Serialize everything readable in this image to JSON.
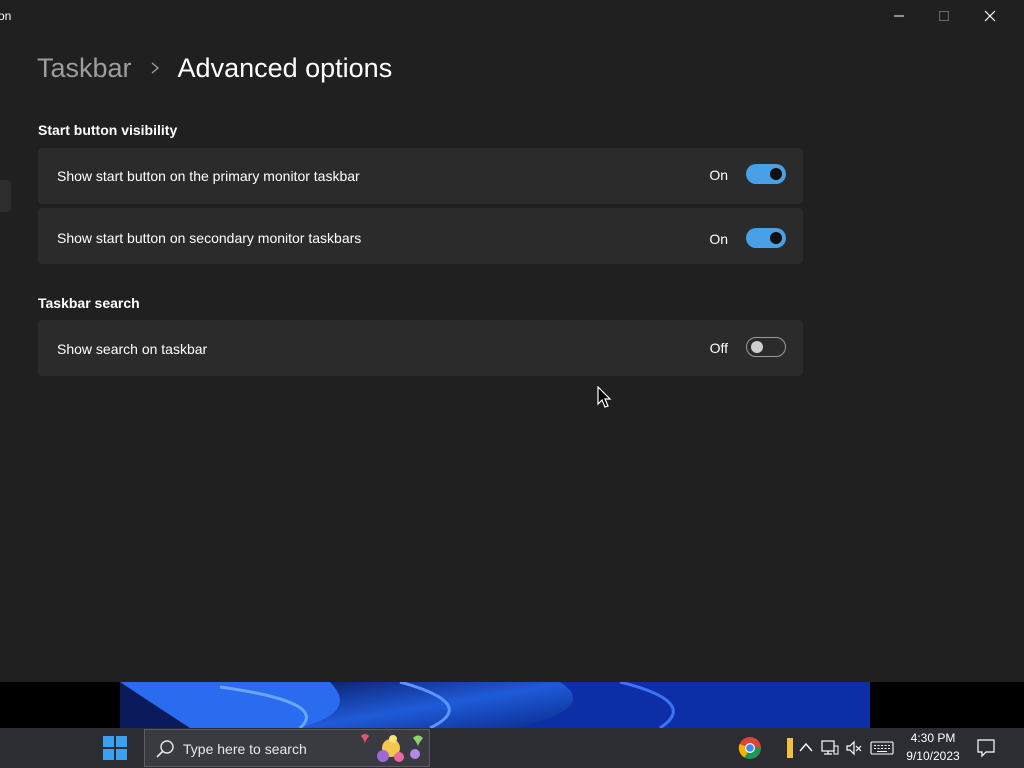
{
  "window": {
    "title_fragment": "on"
  },
  "breadcrumb": {
    "parent": "Taskbar",
    "current": "Advanced options"
  },
  "sections": [
    {
      "title": "Start button visibility",
      "items": [
        {
          "label": "Show start button on the primary monitor taskbar",
          "state": "On"
        },
        {
          "label": "Show start button on secondary monitor taskbars",
          "state": "On"
        }
      ]
    },
    {
      "title": "Taskbar search",
      "items": [
        {
          "label": "Show search on taskbar",
          "state": "Off"
        }
      ]
    }
  ],
  "taskbar": {
    "search_placeholder": "Type here to search",
    "time": "4:30 PM",
    "date": "9/10/2023"
  },
  "colors": {
    "accent": "#4aa0e6",
    "window_bg": "#202020",
    "card_bg": "#2b2b2b",
    "taskbar_bg": "#2b2d33"
  }
}
